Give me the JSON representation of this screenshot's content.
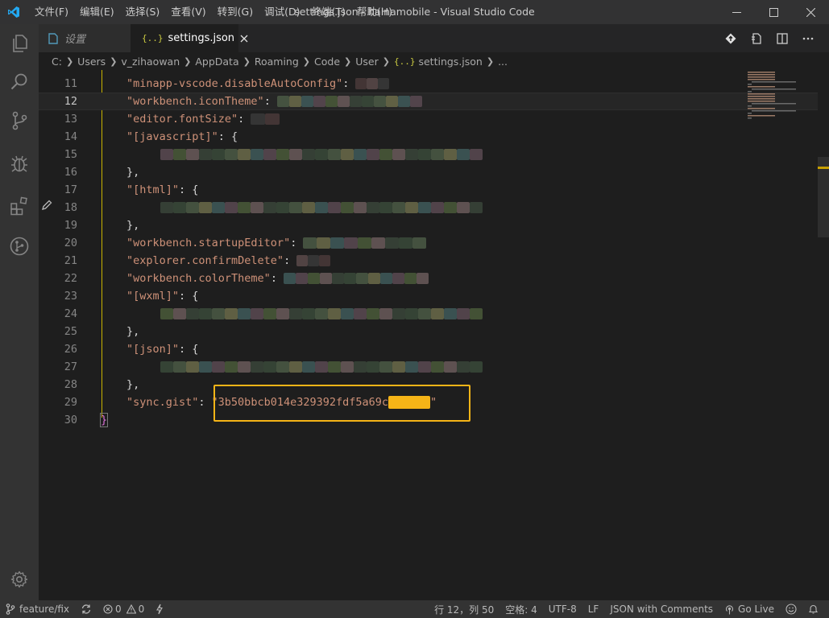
{
  "window": {
    "title": "settings.json - hainamobile - Visual Studio Code"
  },
  "menu": [
    "文件(F)",
    "编辑(E)",
    "选择(S)",
    "查看(V)",
    "转到(G)",
    "调试(D)",
    "终端(T)",
    "帮助(H)"
  ],
  "tabs": [
    {
      "label": "设置",
      "icon": "settings-file-icon",
      "active": false
    },
    {
      "label": "settings.json",
      "icon": "json-braces-icon",
      "active": true
    }
  ],
  "tab_braces": "{..}",
  "breadcrumb": [
    "C:",
    "Users",
    "v_zihaowan",
    "AppData",
    "Roaming",
    "Code",
    "User",
    "settings.json",
    "..."
  ],
  "editor": {
    "language": "JSON with Comments",
    "active_line": 12,
    "lines": [
      {
        "n": "11",
        "key": "\"minapp-vscode.disableAutoConfig\"",
        "after": ":",
        "blur": "short"
      },
      {
        "n": "12",
        "key": "\"workbench.iconTheme\"",
        "after": ":",
        "blur": "long"
      },
      {
        "n": "13",
        "key": "\"editor.fontSize\"",
        "after": ":",
        "blur": "tiny"
      },
      {
        "n": "14",
        "key": "\"[javascript]\"",
        "after": ": {"
      },
      {
        "n": "15",
        "indent": true,
        "blur": "wide"
      },
      {
        "n": "16",
        "closer": "},"
      },
      {
        "n": "17",
        "key": "\"[html]\"",
        "after": ": {"
      },
      {
        "n": "18",
        "indent": true,
        "blur": "wide"
      },
      {
        "n": "19",
        "closer": "},"
      },
      {
        "n": "20",
        "key": "\"workbench.startupEditor\"",
        "after": ":",
        "blur": "med"
      },
      {
        "n": "21",
        "key": "\"explorer.confirmDelete\"",
        "after": ":",
        "blur": "short"
      },
      {
        "n": "22",
        "key": "\"workbench.colorTheme\"",
        "after": ":",
        "blur": "long"
      },
      {
        "n": "23",
        "key": "\"[wxml]\"",
        "after": ": {"
      },
      {
        "n": "24",
        "indent": true,
        "blur": "wide"
      },
      {
        "n": "25",
        "closer": "},"
      },
      {
        "n": "26",
        "key": "\"[json]\"",
        "after": ": {"
      },
      {
        "n": "27",
        "indent": true,
        "blur": "wide"
      },
      {
        "n": "28",
        "closer": "},"
      },
      {
        "n": "29",
        "key": "\"sync.gist\"",
        "after": ":",
        "value": "\"3b50bbcb014e329392fdf5a69c",
        "redact_end": "\""
      },
      {
        "n": "30",
        "root_close": "}"
      }
    ]
  },
  "status": {
    "branch": "feature/fix",
    "errors": "0",
    "warnings": "0",
    "position": "行 12，列 50",
    "spaces": "空格: 4",
    "encoding": "UTF-8",
    "eol": "LF",
    "language": "JSON with Comments",
    "golive": "Go Live"
  },
  "colors": {
    "accent_vscode": "#23a9f2",
    "highlight_box": "#f5b417",
    "json_key": "#ce9178",
    "json_string": "#ce9178"
  }
}
